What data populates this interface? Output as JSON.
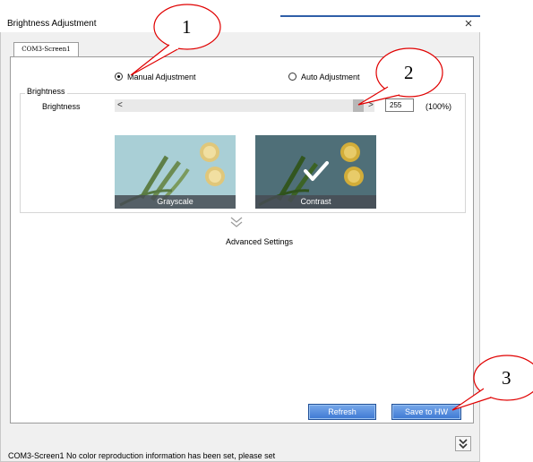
{
  "window": {
    "title": "Brightness Adjustment",
    "close_glyph": "×"
  },
  "tab": {
    "label": "COM3-Screen1"
  },
  "mode": {
    "manual_label": "Manual Adjustment",
    "auto_label": "Auto Adjustment",
    "selected": "manual"
  },
  "brightness": {
    "group_label": "Brightness",
    "row_label": "Brightness",
    "left_arrow": "<",
    "right_arrow": ">",
    "value": "255",
    "percent_text": "(100%)",
    "level_fraction": 1.0
  },
  "tiles": [
    {
      "caption": "Grayscale",
      "selected": false
    },
    {
      "caption": "Contrast",
      "selected": true
    }
  ],
  "advanced": {
    "label": "Advanced Settings"
  },
  "buttons": {
    "refresh": "Refresh",
    "save": "Save to HW"
  },
  "status": {
    "text": "COM3-Screen1 No color reproduction information has been set, please set"
  },
  "callouts": [
    "1",
    "2",
    "3"
  ],
  "icons": {
    "close": "close-icon",
    "check": "checkmark-icon",
    "chevron": "double-chevron-down-icon",
    "expand": "double-chevron-down-icon"
  },
  "colors": {
    "accent_button": "#4a86d9",
    "callout_stroke": "#e00000",
    "title_accent_line": "#2f5fa8"
  }
}
